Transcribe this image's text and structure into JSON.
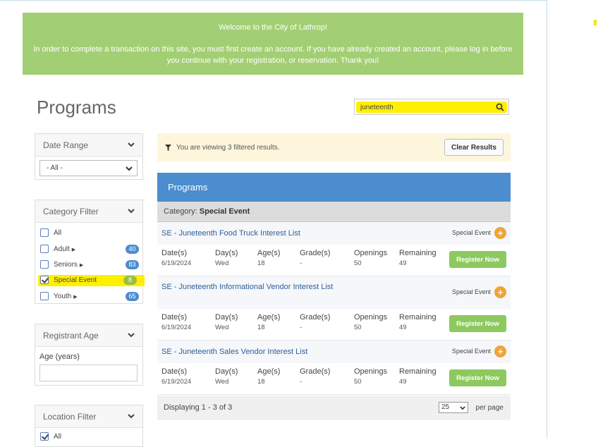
{
  "banner": {
    "line1": "Welcome to the City of Lathrop!",
    "line2": "In order to complete a transaction on this site, you must first create an account. If you have already created an account, please log in before you continue with your registration, or reservation. Thank you!"
  },
  "page_title": "Programs",
  "search": {
    "value": "juneteenth"
  },
  "filters": {
    "date_range": {
      "label": "Date Range",
      "selected": "- All -"
    },
    "category": {
      "label": "Category Filter",
      "items": [
        {
          "label": "All",
          "count": "",
          "expandable": false,
          "checked": false
        },
        {
          "label": "Adult",
          "count": "40",
          "expandable": true,
          "checked": false
        },
        {
          "label": "Seniors",
          "count": "83",
          "expandable": true,
          "checked": false
        },
        {
          "label": "Special Event",
          "count": "8",
          "expandable": false,
          "checked": true
        },
        {
          "label": "Youth",
          "count": "65",
          "expandable": true,
          "checked": false
        }
      ]
    },
    "registrant_age": {
      "label": "Registrant Age",
      "field_label": "Age (years)"
    },
    "location": {
      "label": "Location Filter",
      "first_item": "All"
    }
  },
  "notice": {
    "text": "You are viewing 3 filtered results.",
    "clear_label": "Clear Results"
  },
  "programs": {
    "header": "Programs",
    "category_prefix": "Category:",
    "category_name": "Special Event",
    "columns": {
      "dates": "Date(s)",
      "days": "Day(s)",
      "ages": "Age(s)",
      "grades": "Grade(s)",
      "openings": "Openings",
      "remaining": "Remaining"
    },
    "register_label": "Register Now",
    "items": [
      {
        "title": "SE - Juneteenth Food Truck Interest List",
        "type": "Special Event",
        "date": "6/19/2024",
        "day": "Wed",
        "age": "18",
        "grade": "-",
        "openings": "50",
        "remaining": "49"
      },
      {
        "title": "SE - Juneteenth Informational Vendor Interest List",
        "type": "Special Event",
        "date": "6/19/2024",
        "day": "Wed",
        "age": "18",
        "grade": "-",
        "openings": "50",
        "remaining": "49"
      },
      {
        "title": "SE - Juneteenth Sales Vendor Interest List",
        "type": "Special Event",
        "date": "6/19/2024",
        "day": "Wed",
        "age": "18",
        "grade": "-",
        "openings": "50",
        "remaining": "49"
      }
    ],
    "footer": {
      "displaying": "Displaying 1 - 3 of 3",
      "per_page_value": "25",
      "per_page_label": "per page"
    }
  },
  "colors": {
    "accent_blue": "#4b8dcf",
    "banner_green": "#a3cf74",
    "register_green": "#8dc95e",
    "plus_orange": "#f0a436",
    "highlight_yellow": "#ffef00"
  }
}
